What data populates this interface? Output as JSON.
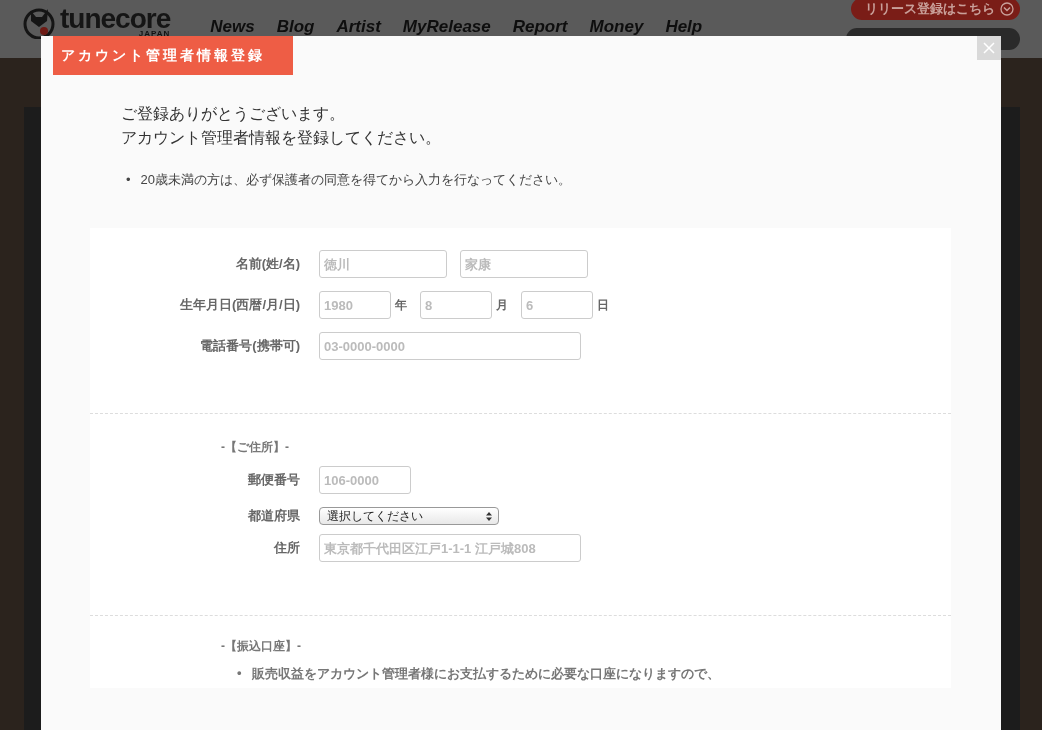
{
  "header": {
    "logo_text": "tunecore",
    "logo_sub": "JAPAN",
    "nav": [
      "News",
      "Blog",
      "Artist",
      "MyRelease",
      "Report",
      "Money",
      "Help"
    ],
    "release_button": "リリース登録はこちら"
  },
  "dialog": {
    "title": "アカウント管理者情報登録",
    "intro": [
      "ご登録ありがとうございます。",
      "アカウント管理者情報を登録してください。"
    ],
    "notes": [
      {
        "bullet": "•",
        "text": "20歳未満の方は、必ず保護者の同意を得てから入力を行なってください。"
      }
    ],
    "sections": [
      {
        "rows": [
          {
            "label": "名前(姓/名)",
            "fields": [
              {
                "kind": "medium",
                "placeholder": "徳川"
              },
              {
                "kind": "medium",
                "placeholder": "家康"
              }
            ]
          },
          {
            "label": "生年月日(西暦/月/日)",
            "fields": [
              {
                "kind": "short",
                "placeholder": "1980",
                "suffix": "年"
              },
              {
                "kind": "short",
                "placeholder": "8",
                "suffix": "月"
              },
              {
                "kind": "short",
                "placeholder": "6",
                "suffix": "日"
              }
            ]
          },
          {
            "label": "電話番号(携帯可)",
            "fields": [
              {
                "kind": "long",
                "placeholder": "03-0000-0000"
              }
            ]
          }
        ]
      },
      {
        "heading": "-【ご住所】-",
        "rows": [
          {
            "label": "郵便番号",
            "fields": [
              {
                "kind": "postal",
                "placeholder": "106-0000"
              }
            ]
          },
          {
            "label": "都道府県",
            "fields": [
              {
                "kind": "select",
                "value": "選択してください"
              }
            ]
          },
          {
            "label": "住所",
            "fields": [
              {
                "kind": "long",
                "placeholder": "東京都千代田区江戸1-1-1 江戸城808"
              }
            ]
          }
        ]
      },
      {
        "heading": "-【振込口座】-",
        "notes": [
          {
            "bullet": "•",
            "text": "販売収益をアカウント管理者様にお支払するために必要な口座になりますので、"
          }
        ]
      }
    ]
  }
}
